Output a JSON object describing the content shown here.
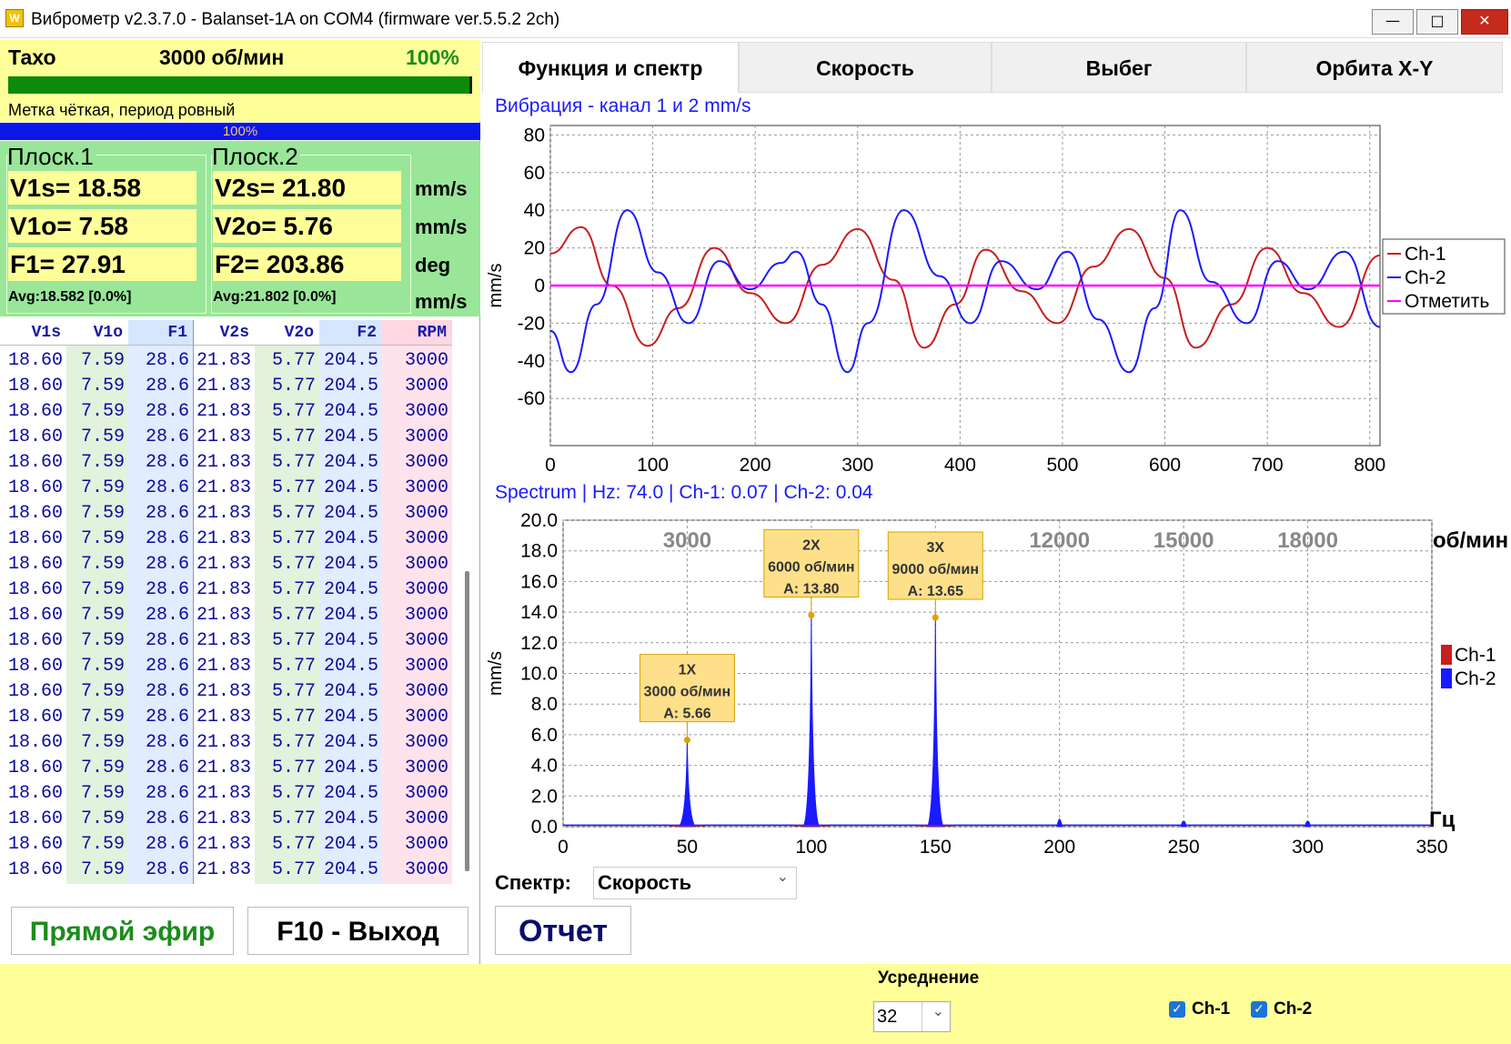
{
  "window": {
    "title": "Виброметр v2.3.7.0 - Balanset-1A on COM4 (firmware ver.5.5.2 2ch)",
    "app_icon": "vibrometer-app-icon",
    "minimize": "—",
    "maximize": "□",
    "close": "✕"
  },
  "taxo": {
    "label": "Тахо",
    "rpm": "3000 об/мин",
    "percent": "100%",
    "bar_fraction": 1.0,
    "status": "Метка чёткая, период ровный",
    "signal_percent": "100%"
  },
  "planes": [
    {
      "title": "Плоск.1",
      "vs": "V1s= 18.58",
      "vo": "V1o= 7.58",
      "f": "F1= 27.91",
      "avg": "Avg:18.582 [0.0%]"
    },
    {
      "title": "Плоск.2",
      "vs": "V2s= 21.80",
      "vo": "V2o= 5.76",
      "f": "F2= 203.86",
      "avg": "Avg:21.802 [0.0%]"
    }
  ],
  "units": [
    "mm/s",
    "mm/s",
    "deg",
    "mm/s"
  ],
  "table": {
    "headers": [
      "V1s",
      "V1o",
      "F1",
      "V2s",
      "V2o",
      "F2",
      "RPM"
    ],
    "row": [
      "18.60",
      "7.59",
      "28.6",
      "21.83",
      "5.77",
      "204.5",
      "3000"
    ],
    "row_count": 21
  },
  "buttons": {
    "live": "Прямой эфир",
    "exit": "F10 - Выход",
    "report": "Отчет"
  },
  "tabs": [
    "Функция и спектр",
    "Скорость",
    "Выбег",
    "Орбита X-Y"
  ],
  "spectrum_select": {
    "label": "Спектр:",
    "value": "Скорость"
  },
  "averaging": {
    "label": "Усреднение",
    "value": "32"
  },
  "channels": [
    {
      "label": "Ch-1",
      "checked": true
    },
    {
      "label": "Ch-2",
      "checked": true
    }
  ],
  "colors": {
    "ch1": "#c81e1e",
    "ch2": "#1a1aff",
    "mark": "#ff00ff",
    "taxo_bg": "#ffff99",
    "values_bg": "#99e699"
  },
  "chart_data": [
    {
      "type": "line",
      "title": "Вибрация  - канал 1 и 2 mm/s",
      "ylabel": "mm/s",
      "xlim": [
        0,
        810
      ],
      "ylim": [
        -85,
        85
      ],
      "xticks": [
        0,
        100,
        200,
        300,
        400,
        500,
        600,
        700,
        800
      ],
      "yticks": [
        80,
        60,
        40,
        20,
        0,
        -20,
        -40,
        -60
      ],
      "grid": true,
      "legend_position": "right",
      "legend": [
        "Ch-1",
        "Ch-2",
        "Отметить"
      ],
      "series": [
        {
          "name": "Ch-1",
          "color": "#c81e1e",
          "x": [
            0,
            30,
            60,
            95,
            125,
            160,
            195,
            230,
            265,
            300,
            335,
            365,
            395,
            425,
            460,
            495,
            530,
            565,
            600,
            630,
            665,
            700,
            735,
            770,
            810
          ],
          "y": [
            17,
            31,
            0,
            -32,
            -12,
            20,
            -4,
            -20,
            11,
            30,
            3,
            -33,
            -10,
            19,
            -3,
            -20,
            10,
            30,
            4,
            -33,
            -10,
            20,
            -4,
            -22,
            16
          ]
        },
        {
          "name": "Ch-2",
          "color": "#1a1aff",
          "x": [
            0,
            20,
            45,
            75,
            105,
            135,
            165,
            195,
            225,
            240,
            265,
            290,
            310,
            345,
            380,
            410,
            440,
            475,
            505,
            535,
            565,
            590,
            615,
            645,
            680,
            710,
            740,
            775,
            810
          ],
          "y": [
            -24,
            -46,
            -10,
            40,
            7,
            -20,
            13,
            -2,
            12,
            18,
            -10,
            -46,
            -20,
            40,
            5,
            -20,
            13,
            -2,
            18,
            -18,
            -46,
            -12,
            40,
            2,
            -20,
            13,
            -2,
            18,
            -22
          ]
        },
        {
          "name": "Отметить",
          "color": "#ff00ff",
          "x": [
            0,
            810
          ],
          "y": [
            0,
            0
          ]
        }
      ]
    },
    {
      "type": "line",
      "title": "Spectrum | Hz: 74.0 | Ch-1: 0.07 | Ch-2: 0.04",
      "ylabel": "mm/s",
      "xlabel": "Гц",
      "secondary_xlabel": "об/мин",
      "xlim": [
        0,
        350
      ],
      "ylim": [
        0,
        20
      ],
      "xticks": [
        0,
        50,
        100,
        150,
        200,
        250,
        300,
        350
      ],
      "secondary_xticks": [
        "3000",
        "6000",
        "9000",
        "12000",
        "15000",
        "18000"
      ],
      "yticks": [
        "20.0",
        "18.0",
        "16.0",
        "14.0",
        "12.0",
        "10.0",
        "8.0",
        "6.0",
        "4.0",
        "2.0",
        "0.0"
      ],
      "grid": true,
      "legend_position": "right",
      "legend": [
        "Ch-1",
        "Ch-2"
      ],
      "peaks": [
        {
          "hz": 50,
          "amp": 5.66
        },
        {
          "hz": 100,
          "amp": 13.8
        },
        {
          "hz": 150,
          "amp": 13.65
        },
        {
          "hz": 200,
          "amp": 0.5
        },
        {
          "hz": 250,
          "amp": 0.3
        },
        {
          "hz": 300,
          "amp": 0.3
        }
      ],
      "annotations": [
        {
          "hz": 50,
          "amp": 5.66,
          "lines": [
            "1X",
            "3000 об/мин",
            "A: 5.66"
          ]
        },
        {
          "hz": 100,
          "amp": 13.8,
          "lines": [
            "2X",
            "6000 об/мин",
            "A: 13.80"
          ]
        },
        {
          "hz": 150,
          "amp": 13.65,
          "lines": [
            "3X",
            "9000 об/мин",
            "A: 13.65"
          ]
        }
      ]
    }
  ]
}
